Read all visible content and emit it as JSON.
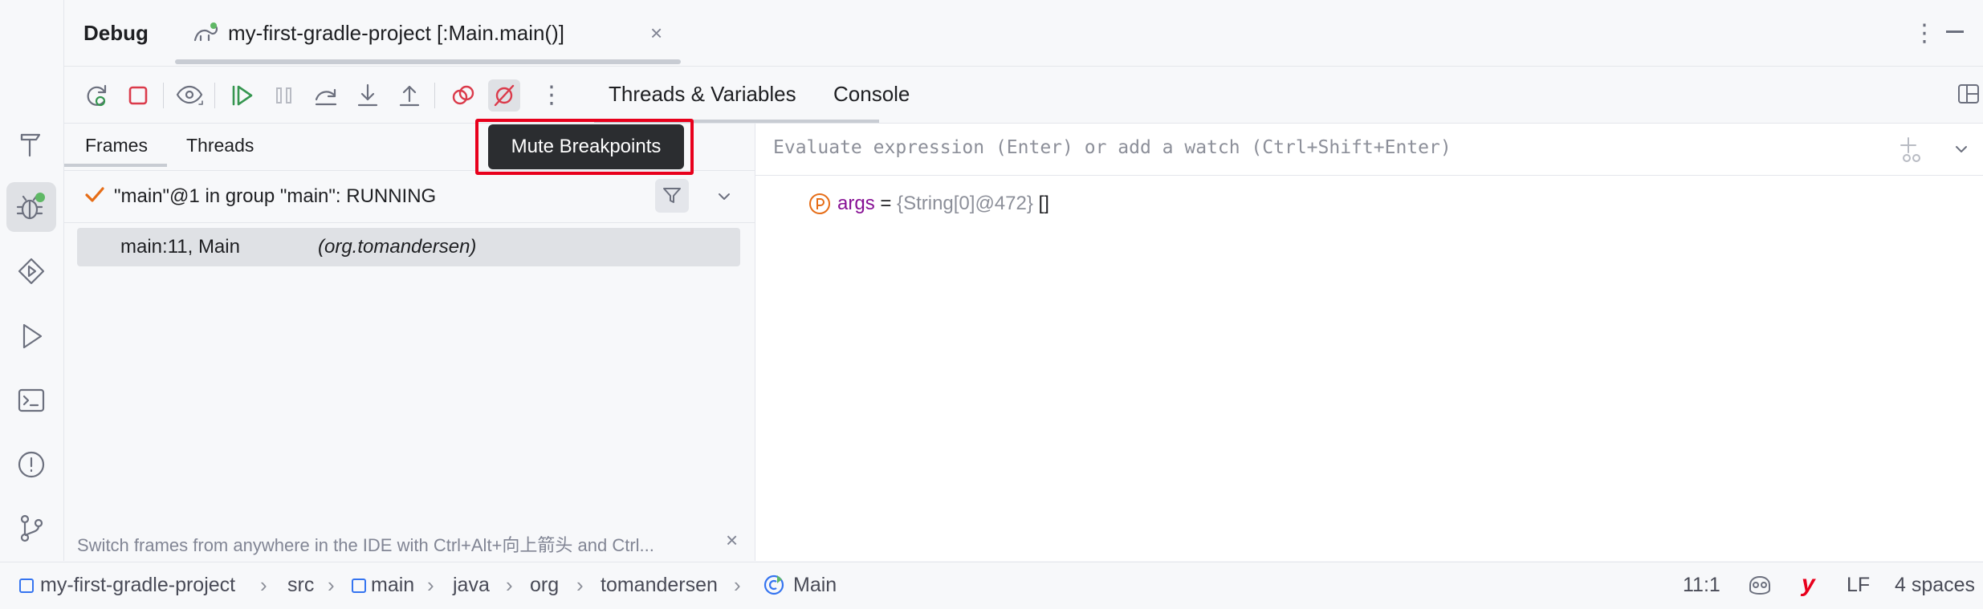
{
  "header": {
    "title": "Debug",
    "session_tab": "my-first-gradle-project [:Main.main()]"
  },
  "toolbar": {
    "tabs": [
      "Threads & Variables",
      "Console"
    ]
  },
  "tooltip": {
    "text": "Mute Breakpoints"
  },
  "frames": {
    "tabs": [
      "Frames",
      "Threads"
    ],
    "thread": "\"main\"@1 in group \"main\": RUNNING",
    "frame": {
      "location": "main:11, Main",
      "package": "(org.tomandersen)"
    },
    "hint": "Switch frames from anywhere in the IDE with Ctrl+Alt+向上箭头 and Ctrl..."
  },
  "variables": {
    "eval_placeholder": "Evaluate expression (Enter) or add a watch (Ctrl+Shift+Enter)",
    "items": [
      {
        "name": "args",
        "eq": " = ",
        "type": "{String[0]@472}",
        "value": " []"
      }
    ]
  },
  "statusbar": {
    "breadcrumbs": [
      "my-first-gradle-project",
      "src",
      "main",
      "java",
      "org",
      "tomandersen",
      "Main"
    ],
    "position": "11:1",
    "line_ending": "LF",
    "indent": "4 spaces"
  },
  "colors": {
    "accent_red": "#e8001c",
    "resume_green": "#369650",
    "stop_red": "#db3b4b",
    "param_orange": "#e66d17",
    "status_green": "#5fb865"
  }
}
